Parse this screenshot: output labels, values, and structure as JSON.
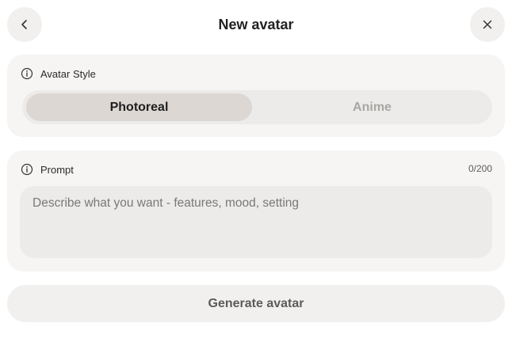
{
  "header": {
    "title": "New avatar",
    "back_icon": "chevron-left-icon",
    "close_icon": "close-icon"
  },
  "style_section": {
    "label": "Avatar Style",
    "icon": "info-icon",
    "options": [
      "Photoreal",
      "Anime"
    ],
    "selected": "Photoreal"
  },
  "prompt_section": {
    "label": "Prompt",
    "icon": "info-icon",
    "counter": "0/200",
    "value": "",
    "placeholder": "Describe what you want - features, mood, setting"
  },
  "actions": {
    "generate_label": "Generate avatar"
  },
  "colors": {
    "card_bg": "#f6f5f4",
    "segment_bg": "#ecebea",
    "segment_selected": "#dcd7d3",
    "button_bg": "#f1f0ee"
  }
}
